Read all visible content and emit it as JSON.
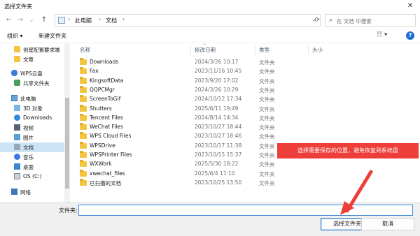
{
  "window": {
    "title": "选择文件夹",
    "close_label": "✕"
  },
  "nav": {
    "back": "←",
    "forward": "→",
    "dropdown": "⌄",
    "up": "↑",
    "breadcrumbs": [
      "此电脑",
      "文档"
    ],
    "separator": "›",
    "address_dropdown": "⌄",
    "refresh": "⟳",
    "search_placeholder": "在 文档 中搜索"
  },
  "toolbar": {
    "organize": "组织 ▾",
    "new_folder": "新建文件夹",
    "view": "☷ ▾",
    "help": "?"
  },
  "sidebar": {
    "items": [
      {
        "label": "创星配置要求端",
        "icon": "folder"
      },
      {
        "label": "文章",
        "icon": "folder"
      },
      {
        "label": "WPS云盘",
        "icon": "cloud"
      },
      {
        "label": "共享文件夹",
        "icon": "share"
      },
      {
        "label": "此电脑",
        "icon": "pc"
      },
      {
        "label": "3D 对象",
        "icon": "3d"
      },
      {
        "label": "Downloads",
        "icon": "download"
      },
      {
        "label": "视频",
        "icon": "video"
      },
      {
        "label": "图片",
        "icon": "image"
      },
      {
        "label": "文档",
        "icon": "doc"
      },
      {
        "label": "音乐",
        "icon": "music"
      },
      {
        "label": "桌面",
        "icon": "desktop"
      },
      {
        "label": "OS (C:)",
        "icon": "drive"
      },
      {
        "label": "网络",
        "icon": "network"
      }
    ]
  },
  "columns": {
    "name": "名称",
    "date": "修改日期",
    "type": "类型",
    "size": "大小"
  },
  "files": [
    {
      "name": "Downloads",
      "date": "2024/3/26 10:17",
      "type": "文件夹"
    },
    {
      "name": "Fax",
      "date": "2023/11/16 10:45",
      "type": "文件夹"
    },
    {
      "name": "KingsoftData",
      "date": "2023/9/20 17:02",
      "type": "文件夹"
    },
    {
      "name": "QQPCMgr",
      "date": "2024/3/26 10:29",
      "type": "文件夹"
    },
    {
      "name": "ScreenToGif",
      "date": "2024/10/12 17:34",
      "type": "文件夹"
    },
    {
      "name": "Shutters",
      "date": "2025/6/11 19:49",
      "type": "文件夹"
    },
    {
      "name": "Tencent Files",
      "date": "2024/8/14 14:34",
      "type": "文件夹"
    },
    {
      "name": "WeChat Files",
      "date": "2023/10/27 18:44",
      "type": "文件夹"
    },
    {
      "name": "WPS Cloud Files",
      "date": "2023/10/27 18:46",
      "type": "文件夹"
    },
    {
      "name": "WPSDrive",
      "date": "2023/10/17 11:38",
      "type": "文件夹"
    },
    {
      "name": "WPSPrinter Files",
      "date": "2023/10/15 15:37",
      "type": "文件夹"
    },
    {
      "name": "WXWork",
      "date": "2025/5/30 18:22",
      "type": "文件夹"
    },
    {
      "name": "xwechat_files",
      "date": "2025/6/4 11:10",
      "type": "文件夹"
    },
    {
      "name": "已扫描的文档",
      "date": "2023/10/25 13:50",
      "type": "文件夹"
    }
  ],
  "footer": {
    "folder_label": "文件夹:",
    "folder_value": "",
    "select_button": "选择文件夹",
    "cancel_button": "取消"
  },
  "annotation": {
    "text": "选择需要保存的位置，避免恢复到系统盘",
    "color": "#ee3e3a"
  }
}
